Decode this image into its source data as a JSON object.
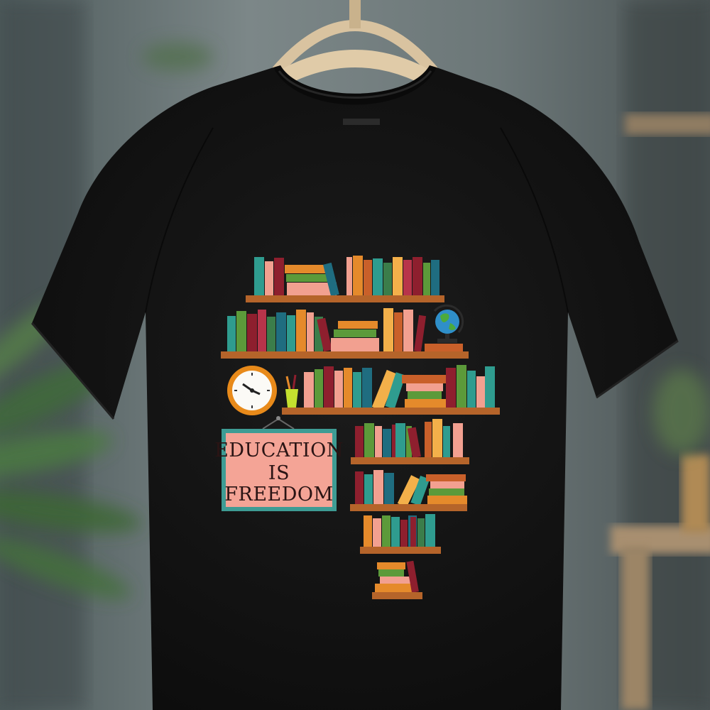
{
  "sign": {
    "line1": "EDUCATION",
    "line2": "IS",
    "line3": "FREEDOM"
  },
  "colors": {
    "shirt": "#141414",
    "shelf_wood": "#b5642a",
    "sign_bg": "#f4a496",
    "sign_border": "#3e9c94",
    "clock_rim": "#e88a1a",
    "book_palette": [
      "#2f9c8f",
      "#e58a2b",
      "#f2a090",
      "#8e1f2e",
      "#5c9a3a",
      "#1f6d80",
      "#c9602a",
      "#f3b04a",
      "#b8344a",
      "#3b7d4a",
      "#e9d3b8"
    ]
  },
  "icons": [
    "clock-icon",
    "globe-icon",
    "pencil-cup-icon",
    "hanger-icon"
  ]
}
